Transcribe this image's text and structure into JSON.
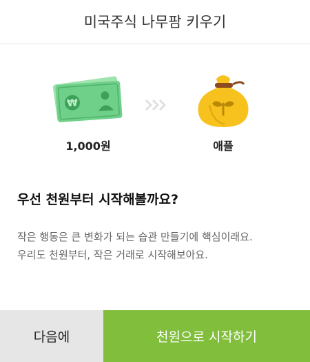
{
  "dialog": {
    "title": "미국주식 나무팜 키우기",
    "exchange": {
      "from_icon": "banknote-won-icon",
      "from_label": "1,000원",
      "arrow_icon": "chevron-triple-right-icon",
      "to_icon": "seed-pouch-icon",
      "to_label": "애플"
    },
    "headline": "우선 천원부터 시작해볼까요?",
    "body_lines": [
      "작은 행동은 큰 변화가 되는 습관 만들기에 핵심이래요.",
      "우리도 천원부터, 작은 거래로 시작해보아요."
    ],
    "buttons": {
      "later_label": "다음에",
      "start_label": "천원으로 시작하기"
    },
    "colors": {
      "primary": "#80be3c",
      "secondary": "#e6e6e6",
      "banknote": "#6fd08a",
      "pouch": "#f7c21d"
    }
  }
}
